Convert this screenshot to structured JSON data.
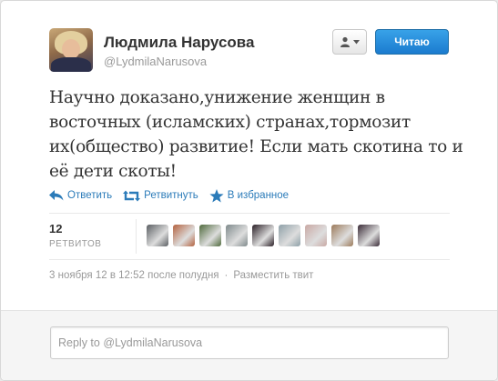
{
  "user": {
    "display_name": "Людмила Нарусова",
    "screen_name": "@LydmilaNarusova"
  },
  "header": {
    "follow_label": "Читаю",
    "dropdown_icon": "user-icon"
  },
  "tweet": {
    "text": "Научно доказано,унижение женщин в восточных (исламских) странах,тормозит их(общество) развитие! Если мать скотина то и её дети скоты!"
  },
  "actions": {
    "reply_label": "Ответить",
    "retweet_label": "Ретвитнуть",
    "favorite_label": "В избранное"
  },
  "stats": {
    "retweet_count": "12",
    "retweet_caption": "РЕТВИТОВ",
    "retweeter_avatars": [
      {
        "color": "#5b5f63"
      },
      {
        "color": "#b4623f"
      },
      {
        "color": "#4f6a3c"
      },
      {
        "color": "#7f8a8c"
      },
      {
        "color": "#2a1f26"
      },
      {
        "color": "#8ea0a8"
      },
      {
        "color": "#c9a9a4"
      },
      {
        "color": "#9c7a5a"
      },
      {
        "color": "#3a2b37"
      }
    ]
  },
  "meta": {
    "timestamp": "3 ноября 12 в 12:52 после полудня",
    "separator": "·",
    "embed_label": "Разместить твит"
  },
  "reply": {
    "placeholder": "Reply to @LydmilaNarusova"
  },
  "colors": {
    "link": "#2b7bb9",
    "follow_button": "#1b7bcf",
    "name": "#333333",
    "muted": "#999999"
  }
}
